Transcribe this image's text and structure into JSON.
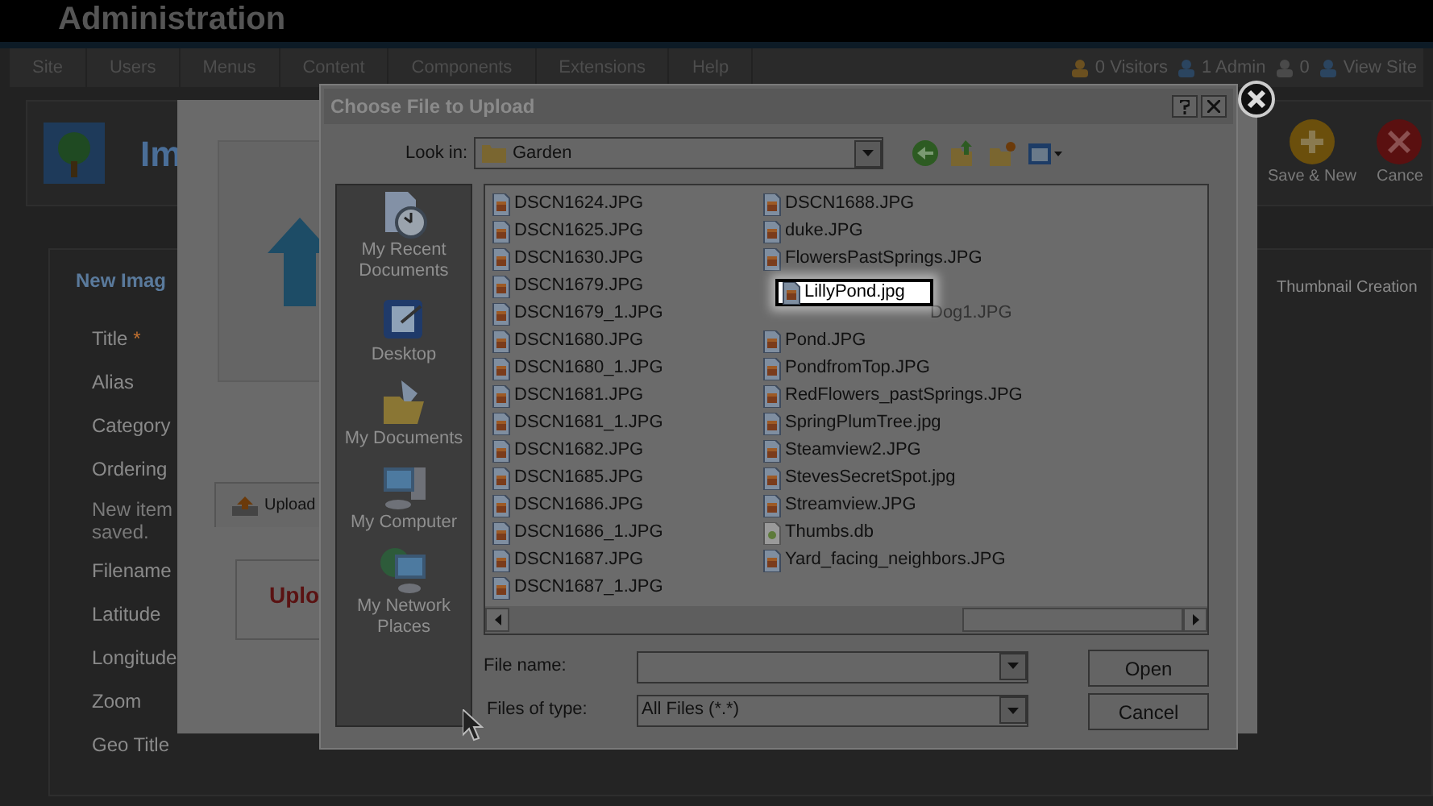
{
  "header": {
    "title": "Administration"
  },
  "menu": [
    "Site",
    "Users",
    "Menus",
    "Content",
    "Components",
    "Extensions",
    "Help"
  ],
  "status": [
    {
      "kind": "visitors",
      "text": "0 Visitors"
    },
    {
      "kind": "admin",
      "text": "1 Admin"
    },
    {
      "kind": "messages",
      "text": "0"
    },
    {
      "kind": "site",
      "text": "View Site"
    }
  ],
  "page": {
    "title": "Im",
    "toolbar": [
      {
        "kind": "add",
        "label": "Save & New"
      },
      {
        "kind": "cancel",
        "label": "Cance"
      }
    ]
  },
  "form": {
    "legend": "New Imag",
    "fields": [
      {
        "kind": "label",
        "label": "Title",
        "marker": "*"
      },
      {
        "kind": "label",
        "label": "Alias"
      },
      {
        "kind": "label",
        "label": "Category"
      },
      {
        "kind": "label",
        "label": "Ordering"
      },
      {
        "kind": "note",
        "label": "New item saved."
      },
      {
        "kind": "label",
        "label": "Filename"
      },
      {
        "kind": "label",
        "label": "Latitude"
      },
      {
        "kind": "label",
        "label": "Longitude"
      },
      {
        "kind": "label",
        "label": "Zoom"
      },
      {
        "kind": "label",
        "label": "Geo Title"
      }
    ]
  },
  "right_panel": {
    "tab": "Thumbnail Creation"
  },
  "lightbox": {
    "tab": "Upload",
    "heading": "Uplo"
  },
  "dialog": {
    "title": "Choose File to Upload",
    "look_in_label": "Look in:",
    "look_in": "Garden",
    "places": [
      {
        "kind": "recent",
        "label": "My Recent Documents"
      },
      {
        "kind": "desktop",
        "label": "Desktop"
      },
      {
        "kind": "documents",
        "label": "My Documents"
      },
      {
        "kind": "computer",
        "label": "My Computer"
      },
      {
        "kind": "network",
        "label": "My Network Places"
      }
    ],
    "columns": [
      [
        {
          "kind": "image",
          "name": "DSCN1624.JPG"
        },
        {
          "kind": "image",
          "name": "DSCN1625.JPG"
        },
        {
          "kind": "image",
          "name": "DSCN1630.JPG"
        },
        {
          "kind": "image",
          "name": "DSCN1679.JPG"
        },
        {
          "kind": "image",
          "name": "DSCN1679_1.JPG"
        },
        {
          "kind": "image",
          "name": "DSCN1680.JPG"
        },
        {
          "kind": "image",
          "name": "DSCN1680_1.JPG"
        },
        {
          "kind": "image",
          "name": "DSCN1681.JPG"
        },
        {
          "kind": "image",
          "name": "DSCN1681_1.JPG"
        },
        {
          "kind": "image",
          "name": "DSCN1682.JPG"
        },
        {
          "kind": "image",
          "name": "DSCN1685.JPG"
        },
        {
          "kind": "image",
          "name": "DSCN1686.JPG"
        },
        {
          "kind": "image",
          "name": "DSCN1686_1.JPG"
        },
        {
          "kind": "image",
          "name": "DSCN1687.JPG"
        },
        {
          "kind": "image",
          "name": "DSCN1687_1.JPG"
        }
      ],
      [
        {
          "kind": "image",
          "name": "DSCN1688.JPG"
        },
        {
          "kind": "image",
          "name": "duke.JPG"
        },
        {
          "kind": "image",
          "name": "FlowersPastSprings.JPG"
        },
        {
          "kind": "dragged",
          "name": "LillyPond.jpg"
        },
        {
          "kind": "covered",
          "name": "Dog1.JPG"
        },
        {
          "kind": "image",
          "name": "Pond.JPG"
        },
        {
          "kind": "image",
          "name": "PondfromTop.JPG"
        },
        {
          "kind": "image",
          "name": "RedFlowers_pastSprings.JPG"
        },
        {
          "kind": "image",
          "name": "SpringPlumTree.jpg"
        },
        {
          "kind": "image",
          "name": "Steamview2.JPG"
        },
        {
          "kind": "image",
          "name": "StevesSecretSpot.jpg"
        },
        {
          "kind": "image",
          "name": "Streamview.JPG"
        },
        {
          "kind": "db",
          "name": "Thumbs.db"
        },
        {
          "kind": "image",
          "name": "Yard_facing_neighbors.JPG"
        }
      ]
    ],
    "file_name_label": "File name:",
    "type_label": "Files of type:",
    "type_value": "All Files (*.*)",
    "buttons": [
      "Open",
      "Cancel"
    ]
  }
}
